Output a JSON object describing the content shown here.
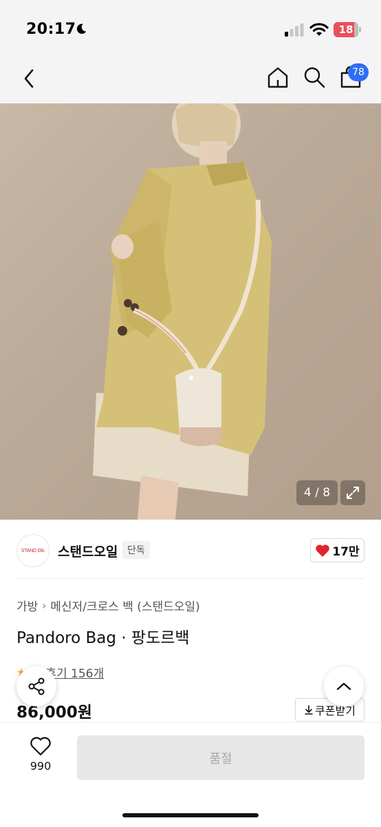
{
  "status_bar": {
    "time": "20:17",
    "battery": "18"
  },
  "nav": {
    "cart_count": "78"
  },
  "gallery": {
    "counter": "4 / 8"
  },
  "brand": {
    "logo_text": "STAND OIL",
    "name": "스탠드오일",
    "exclusive_label": "단독",
    "like_count": "17만"
  },
  "breadcrumb": {
    "category": "가방",
    "subcategory": "메신저/크로스 백 (스탠드오일)"
  },
  "product": {
    "title": "Pandoro Bag · 팡도르백",
    "review_text": "후기 156개",
    "price": "86,000원"
  },
  "coupon": {
    "label": "쿠폰받기"
  },
  "bottom": {
    "wish_count": "990",
    "soldout_label": "품절"
  },
  "colors": {
    "accent_blue": "#2f6df6",
    "heart_red": "#e0262c",
    "jacket": "#d5c077",
    "skirt": "#e6dcc8"
  }
}
